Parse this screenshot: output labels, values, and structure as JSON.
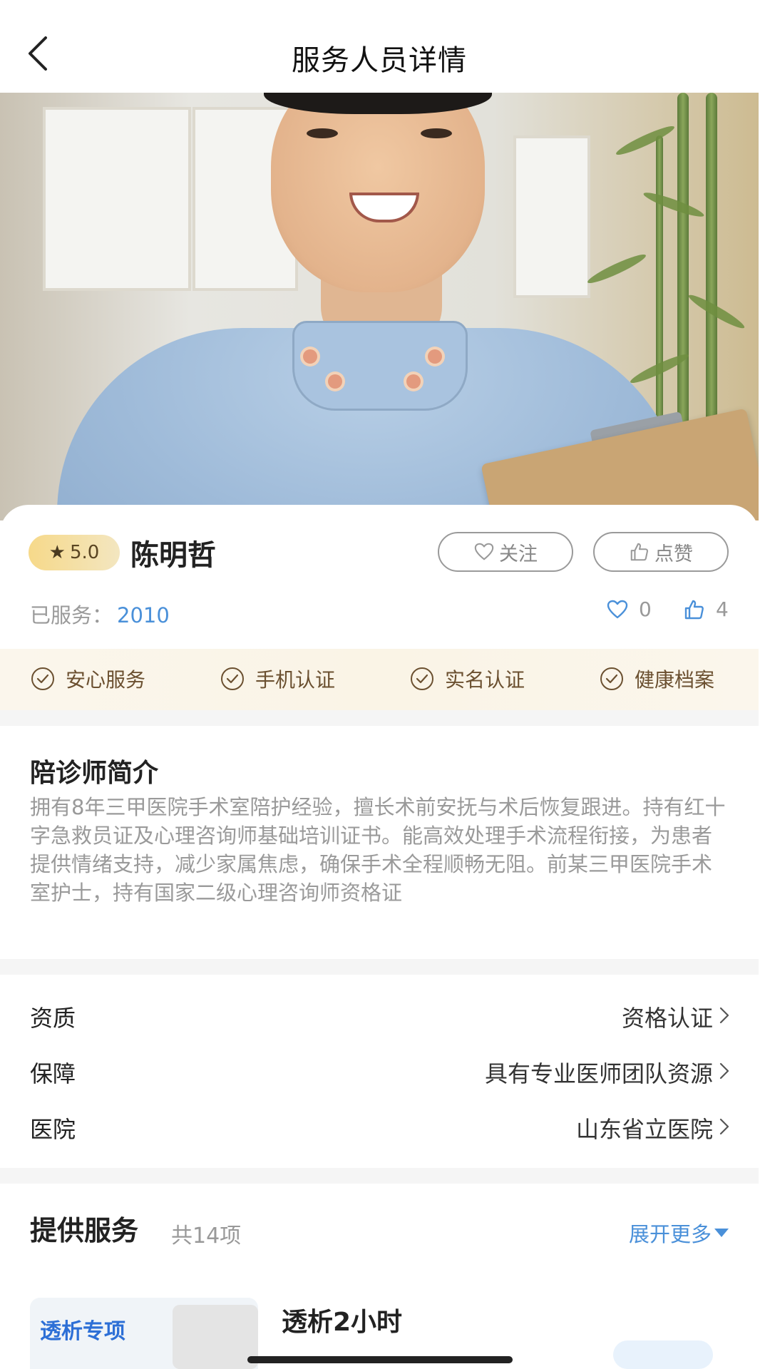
{
  "header": {
    "title": "服务人员详情"
  },
  "profile": {
    "rating": "5.0",
    "name": "陈明哲",
    "follow_label": "关注",
    "like_label": "点赞",
    "served_label": "已服务：",
    "served_count": "2010",
    "favorites_count": "0",
    "likes_count": "4"
  },
  "badges": [
    "安心服务",
    "手机认证",
    "实名认证",
    "健康档案"
  ],
  "intro": {
    "title": "陪诊师简介",
    "text": "拥有8年三甲医院手术室陪护经验，擅长术前安抚与术后恢复跟进。持有红十字急救员证及心理咨询师基础培训证书。能高效处理手术流程衔接，为患者提供情绪支持，减少家属焦虑，确保手术全程顺畅无阻。前某三甲医院手术室护士，持有国家二级心理咨询师资格证"
  },
  "details": [
    {
      "label": "资质",
      "value": "资格认证"
    },
    {
      "label": "保障",
      "value": "具有专业医师团队资源"
    },
    {
      "label": "医院",
      "value": "山东省立医院"
    }
  ],
  "services": {
    "title": "提供服务",
    "count": "共14项",
    "expand_label": "展开更多",
    "items": [
      {
        "tag": "透析专项",
        "name": "透析2小时"
      }
    ]
  },
  "colors": {
    "accent": "#4a90d9",
    "badge_text": "#6b5030",
    "rating_bg": "#f6d98a"
  }
}
